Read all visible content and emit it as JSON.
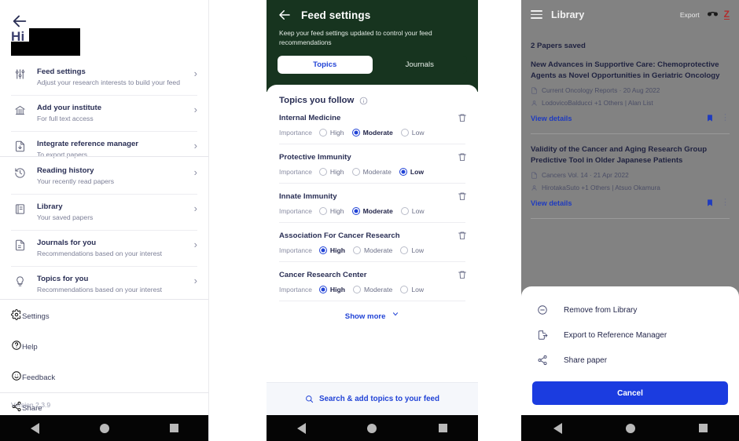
{
  "panel1": {
    "back_icon": "arrow-left-icon",
    "greeting": "Hi",
    "menu_primary": [
      {
        "icon": "sliders-icon",
        "title": "Feed settings",
        "subtitle": "Adjust your research interests to build your feed",
        "chevron": "›"
      },
      {
        "icon": "bank-icon",
        "title": "Add your institute",
        "subtitle": "For full text access",
        "chevron": "›"
      },
      {
        "icon": "document-download-icon",
        "title": "Integrate reference manager",
        "subtitle": "To export papers",
        "chevron": "›"
      }
    ],
    "menu_secondary": [
      {
        "icon": "history-icon",
        "title": "Reading history",
        "subtitle": "Your recently read papers",
        "chevron": "›"
      },
      {
        "icon": "book-icon",
        "title": "Library",
        "subtitle": "Your saved papers",
        "chevron": "›"
      },
      {
        "icon": "journal-icon",
        "title": "Journals for you",
        "subtitle": "Recommendations based on your interest",
        "chevron": "›"
      },
      {
        "icon": "bulb-icon",
        "title": "Topics for you",
        "subtitle": "Recommendations based on your interest",
        "chevron": "›"
      }
    ],
    "menu_tertiary": [
      {
        "icon": "gear-icon",
        "title": "Settings"
      },
      {
        "icon": "help-icon",
        "title": "Help"
      },
      {
        "icon": "feedback-icon",
        "title": "Feedback"
      },
      {
        "icon": "share-icon",
        "title": "Share"
      }
    ],
    "version": "Version 2.3.9"
  },
  "panel2": {
    "back_icon": "arrow-left-icon",
    "title": "Feed settings",
    "description": "Keep your feed settings updated to control your feed recommendations",
    "tabs": [
      {
        "label": "Topics",
        "active": true
      },
      {
        "label": "Journals",
        "active": false
      }
    ],
    "section_title": "Topics you follow",
    "info_icon": "info-icon",
    "importance_label": "Importance",
    "importance_options": [
      "High",
      "Moderate",
      "Low"
    ],
    "topics": [
      {
        "name": "Internal Medicine",
        "importance": "Moderate",
        "delete_icon": "trash-icon"
      },
      {
        "name": "Protective Immunity",
        "importance": "Low",
        "delete_icon": "trash-icon"
      },
      {
        "name": "Innate Immunity",
        "importance": "Moderate",
        "delete_icon": "trash-icon"
      },
      {
        "name": "Association For Cancer Research",
        "importance": "High",
        "delete_icon": "trash-icon"
      },
      {
        "name": "Cancer Research Center",
        "importance": "High",
        "delete_icon": "trash-icon"
      }
    ],
    "show_more_label": "Show more",
    "show_more_icon": "chevron-down-icon",
    "search_label": "Search & add topics to your feed",
    "search_icon": "search-icon",
    "header_color": "#17341f",
    "accent_color": "#2143d6"
  },
  "panel3": {
    "menu_icon": "hamburger-icon",
    "title": "Library",
    "export_label": "Export",
    "mendeley_icon": "mendeley-icon",
    "zotero_icon": "zotero-icon",
    "zotero_letter": "Z",
    "saved_count": "2 Papers saved",
    "papers": [
      {
        "title": "New Advances in Supportive Care: Chemoprotective Agents as Novel Opportunities in Geriatric Oncology",
        "journal_icon": "journal-icon",
        "journal": "Current Oncology Reports · 20 Aug 2022",
        "authors_icon": "person-icon",
        "authors": "LodovicoBalducci +1 Others | Alan List",
        "view_details": "View details",
        "bookmark_icon": "bookmark-filled-icon",
        "more_icon": "kebab-menu-icon"
      },
      {
        "title": "Validity of the Cancer and Aging Research Group Predictive Tool in Older Japanese Patients",
        "journal_icon": "journal-icon",
        "journal": "Cancers Vol. 14 · 21 Apr 2022",
        "authors_icon": "person-icon",
        "authors": "HirotakaSuto +1 Others | Atsuo Okamura",
        "view_details": "View details",
        "bookmark_icon": "bookmark-filled-icon",
        "more_icon": "kebab-menu-icon"
      }
    ],
    "action_sheet": {
      "items": [
        {
          "icon": "minus-circle-icon",
          "label": "Remove from Library"
        },
        {
          "icon": "export-document-icon",
          "label": "Export to Reference Manager"
        },
        {
          "icon": "share-icon",
          "label": "Share paper"
        }
      ],
      "cancel_label": "Cancel",
      "cancel_color": "#1b3ce0"
    }
  },
  "navbar": {
    "back_icon": "nav-back-icon",
    "home_icon": "nav-home-icon",
    "recents_icon": "nav-recents-icon"
  }
}
